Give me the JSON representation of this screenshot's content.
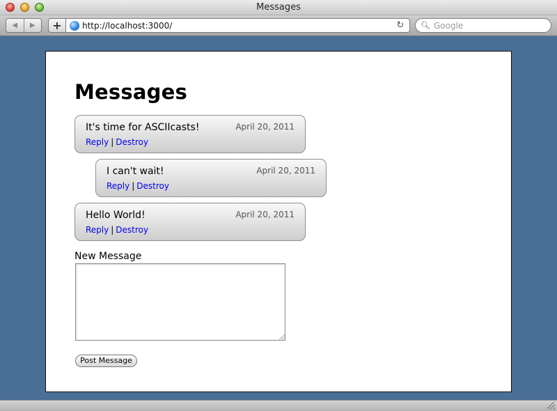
{
  "window": {
    "title": "Messages"
  },
  "toolbar": {
    "url": "http://localhost:3000/",
    "search_placeholder": "Google",
    "add_label": "+"
  },
  "page": {
    "title": "Messages",
    "messages": [
      {
        "body": "It's time for ASCIIcasts!",
        "date": "April 20, 2011",
        "reply": "Reply",
        "destroy": "Destroy",
        "depth": 0
      },
      {
        "body": "I can't wait!",
        "date": "April 20, 2011",
        "reply": "Reply",
        "destroy": "Destroy",
        "depth": 1
      },
      {
        "body": "Hello World!",
        "date": "April 20, 2011",
        "reply": "Reply",
        "destroy": "Destroy",
        "depth": 0
      }
    ],
    "link_separator": "|",
    "form": {
      "label": "New Message",
      "textarea_value": "",
      "submit_label": "Post Message"
    }
  },
  "colors": {
    "page_background": "#4a6f96",
    "link": "#0000ee"
  }
}
